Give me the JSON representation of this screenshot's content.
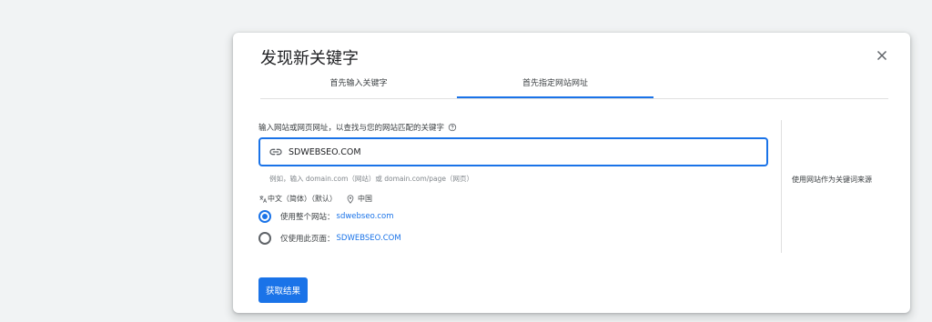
{
  "dialog": {
    "title": "发现新关键字",
    "close_icon": "close-icon",
    "tabs": [
      {
        "label": "首先输入关键字",
        "active": false
      },
      {
        "label": "首先指定网站网址",
        "active": true
      }
    ],
    "prompt": "输入网站或网页网址，以查找与您的网站匹配的关键字",
    "help_icon": "help-circle-icon",
    "url_input": {
      "value": "SDWEBSEO.COM",
      "icon": "link-icon"
    },
    "example": "例如，输入 domain.com（网站）或 domain.com/page（网页）",
    "language": {
      "icon": "translate-icon",
      "label": "中文（简体）（默认）"
    },
    "location": {
      "icon": "location-pin-icon",
      "label": "中国"
    },
    "options": [
      {
        "label": "使用整个网站：",
        "value": "sdwebseo.com",
        "checked": true
      },
      {
        "label": "仅使用此页面：",
        "value": "SDWEBSEO.COM",
        "checked": false
      }
    ],
    "side_note": "使用网站作为关键词来源",
    "submit_label": "获取结果"
  },
  "colors": {
    "accent": "#1a73e8",
    "background": "#f1f3f4",
    "text": "#3c4043"
  }
}
